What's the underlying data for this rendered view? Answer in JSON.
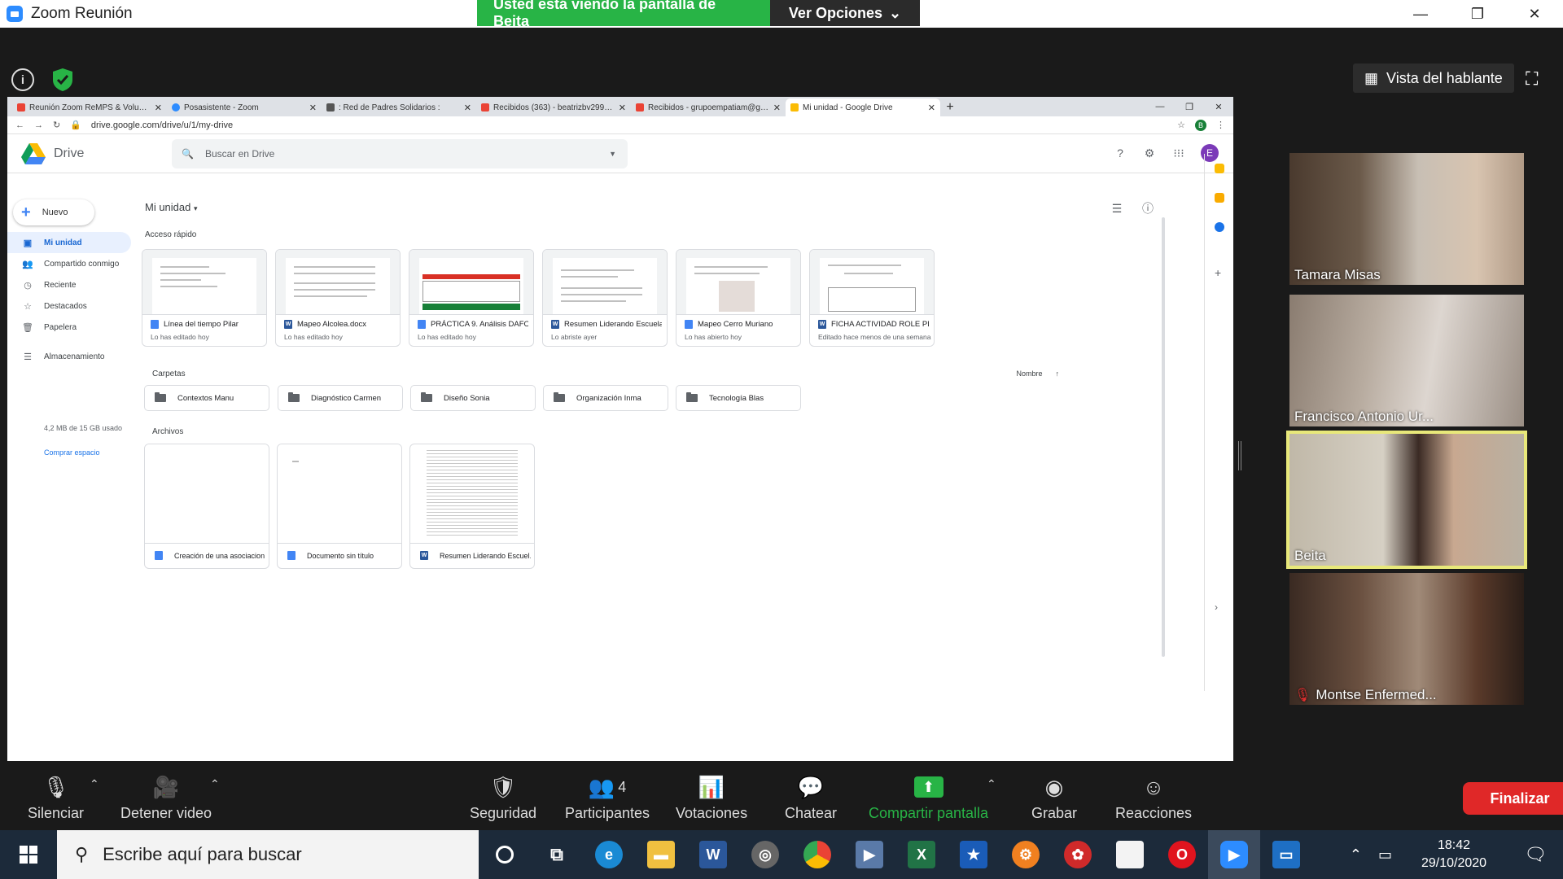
{
  "zoom": {
    "window_title": "Zoom Reunión",
    "share_banner": "Usted está viendo la pantalla de Beita",
    "view_options": "Ver Opciones",
    "speaker_view": "Vista del hablante",
    "end_button": "Finalizar",
    "participant_count": "4",
    "toolbar": {
      "mute": "Silenciar",
      "stop_video": "Detener video",
      "security": "Seguridad",
      "participants": "Participantes",
      "polls": "Votaciones",
      "chat": "Chatear",
      "share_screen": "Compartir pantalla",
      "record": "Grabar",
      "reactions": "Reacciones"
    },
    "participants": [
      {
        "name": "Tamara Misas",
        "muted": false,
        "active": false
      },
      {
        "name": "Francisco Antonio Ur...",
        "muted": false,
        "active": false
      },
      {
        "name": "Beita",
        "muted": false,
        "active": true
      },
      {
        "name": "Montse Enfermed...",
        "muted": true,
        "active": false
      }
    ]
  },
  "chrome": {
    "tabs": [
      {
        "label": "Reunión Zoom ReMPS & Volunta...",
        "favicon": "gmail",
        "active": false
      },
      {
        "label": "Posasistente - Zoom",
        "favicon": "zoom",
        "active": false
      },
      {
        "label": ": Red de Padres Solidarios :",
        "favicon": "tool",
        "active": false
      },
      {
        "label": "Recibidos (363) - beatrizbv2999...",
        "favicon": "gmail",
        "active": false
      },
      {
        "label": "Recibidos - grupoempatiam@gm...",
        "favicon": "gmail",
        "active": false
      },
      {
        "label": "Mi unidad - Google Drive",
        "favicon": "drive",
        "active": true
      }
    ],
    "url": "drive.google.com/drive/u/1/my-drive",
    "profile_initial": "B"
  },
  "drive": {
    "app_name": "Drive",
    "search_placeholder": "Buscar en Drive",
    "avatar_initial": "E",
    "new_button": "Nuevo",
    "sidebar": [
      {
        "label": "Mi unidad",
        "icon": "drive-icon",
        "active": true
      },
      {
        "label": "Compartido conmigo",
        "icon": "people-icon",
        "active": false
      },
      {
        "label": "Reciente",
        "icon": "clock-icon",
        "active": false
      },
      {
        "label": "Destacados",
        "icon": "star-icon",
        "active": false
      },
      {
        "label": "Papelera",
        "icon": "trash-icon",
        "active": false
      }
    ],
    "storage_label": "Almacenamiento",
    "storage_used": "4,2 MB de 15 GB usado",
    "buy_storage": "Comprar espacio",
    "breadcrumb": "Mi unidad",
    "quick_access_title": "Acceso rápido",
    "quick_access": [
      {
        "name": "Línea del tiempo Pilar",
        "type": "gdoc",
        "sub": "Lo has editado hoy"
      },
      {
        "name": "Mapeo Alcolea.docx",
        "type": "word",
        "sub": "Lo has editado hoy"
      },
      {
        "name": "PRÁCTICA 9. Análisis DAFO",
        "type": "gdoc",
        "sub": "Lo has editado hoy"
      },
      {
        "name": "Resumen Liderando Escuela...",
        "type": "word",
        "sub": "Lo abriste ayer"
      },
      {
        "name": "Mapeo Cerro Muriano",
        "type": "gdoc",
        "sub": "Lo has abierto hoy"
      },
      {
        "name": "FICHA ACTIVIDAD ROLE PLA...",
        "type": "word",
        "sub": "Editado hace menos de una semana ..."
      }
    ],
    "folders_title": "Carpetas",
    "sort_label": "Nombre",
    "folders": [
      "Contextos Manu",
      "Diagnóstico Carmen",
      "Diseño Sonia",
      "Organización Inma",
      "Tecnología Blas"
    ],
    "files_title": "Archivos",
    "files": [
      {
        "name": "Creación de una asociacion",
        "type": "gdoc"
      },
      {
        "name": "Documento sin título",
        "type": "gdoc"
      },
      {
        "name": "Resumen Liderando Escuel...",
        "type": "word"
      }
    ]
  },
  "taskbar": {
    "search_placeholder": "Escribe aquí para buscar",
    "time": "18:42",
    "date": "29/10/2020"
  }
}
